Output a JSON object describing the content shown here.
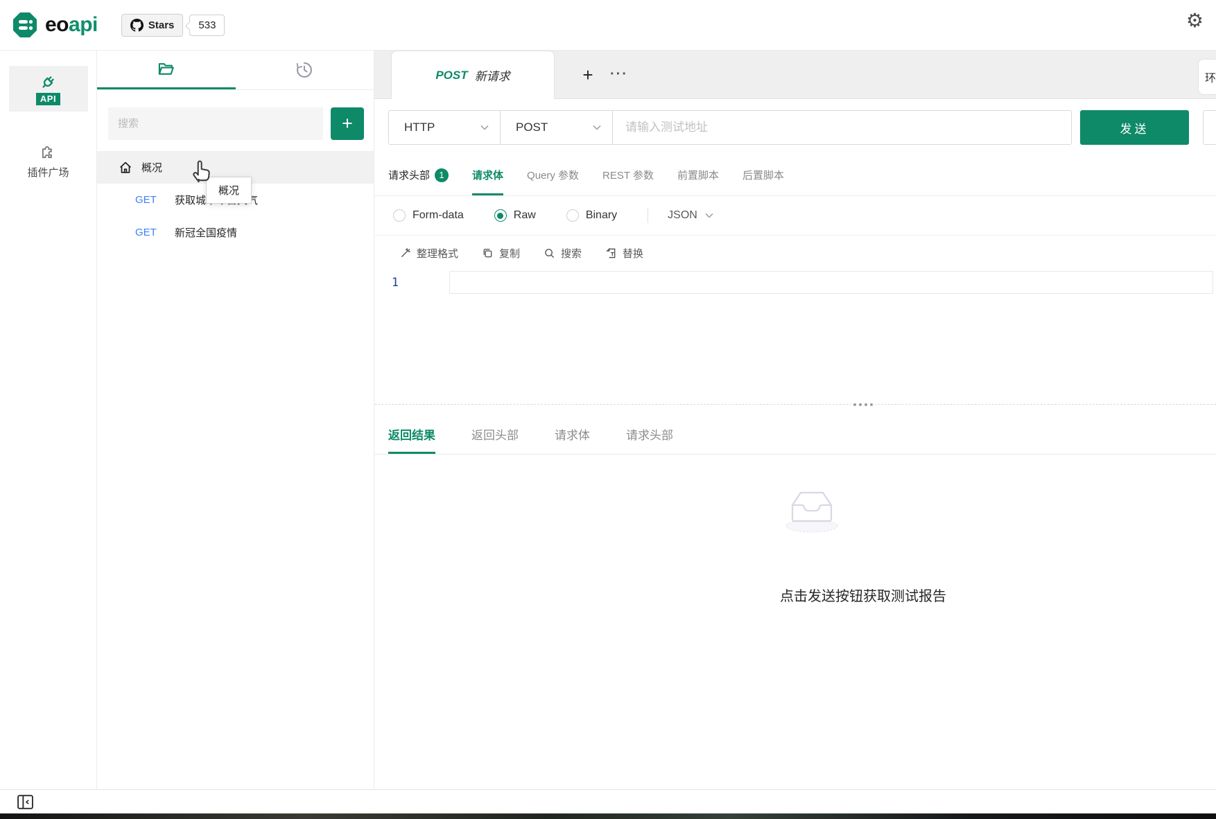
{
  "header": {
    "logo_black": "eo",
    "logo_green": "api",
    "stars_label": "Stars",
    "stars_count": "533"
  },
  "rail": {
    "api_label": "API",
    "plugins_label": "插件广场"
  },
  "explorer": {
    "search_placeholder": "搜索",
    "add_label": "+",
    "group_label": "概况",
    "tooltip": "概况",
    "apis": [
      {
        "method": "GET",
        "name": "获取城市今日天气"
      },
      {
        "method": "GET",
        "name": "新冠全国疫情"
      }
    ]
  },
  "request": {
    "tab_method": "POST",
    "tab_name": "新请求",
    "new_tab_label": "+",
    "more_label": "···",
    "env_partial": "环",
    "protocol": "HTTP",
    "method": "POST",
    "url_placeholder": "请输入测试地址",
    "send_label": "发送",
    "tabs": [
      {
        "label": "请求头部",
        "badge": "1"
      },
      {
        "label": "请求体"
      },
      {
        "label": "Query 参数"
      },
      {
        "label": "REST 参数"
      },
      {
        "label": "前置脚本"
      },
      {
        "label": "后置脚本"
      }
    ],
    "body_types": [
      {
        "label": "Form-data",
        "checked": false
      },
      {
        "label": "Raw",
        "checked": true
      },
      {
        "label": "Binary",
        "checked": false
      }
    ],
    "raw_format": "JSON",
    "toolbar": [
      {
        "label": "整理格式"
      },
      {
        "label": "复制"
      },
      {
        "label": "搜索"
      },
      {
        "label": "替换"
      }
    ],
    "line_number": "1"
  },
  "response": {
    "tabs": [
      {
        "label": "返回结果"
      },
      {
        "label": "返回头部"
      },
      {
        "label": "请求体"
      },
      {
        "label": "请求头部"
      }
    ],
    "empty_text": "点击发送按钮获取测试报告"
  },
  "colors": {
    "accent": "#0e8a68",
    "get_method_blue": "#3d7ff5"
  }
}
